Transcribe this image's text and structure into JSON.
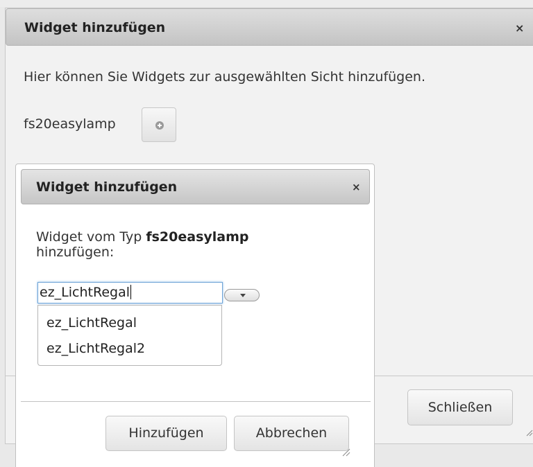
{
  "outer_dialog": {
    "title": "Widget hinzufügen",
    "close_glyph": "×",
    "description": "Hier können Sie Widgets zur ausgewählten Sicht hinzufügen.",
    "widget_type_label": "fs20easylamp",
    "add_icon": "plus-circle-icon",
    "close_button_label": "Schließen"
  },
  "inner_dialog": {
    "title": "Widget hinzufügen",
    "close_glyph": "×",
    "prompt_prefix": "Widget vom Typ ",
    "prompt_type": "fs20easylamp",
    "prompt_suffix": "hinzufügen:",
    "combo_value": "ez_LichtRegal",
    "combo_toggle_icon": "triangle-down-icon",
    "dropdown_options": [
      "ez_LichtRegal",
      "ez_LichtRegal2"
    ],
    "add_button_label": "Hinzufügen",
    "cancel_button_label": "Abbrechen"
  },
  "colors": {
    "focus_border": "#6fa4d6",
    "header_gradient_top": "#dedede",
    "header_gradient_bottom": "#c4c4c4"
  }
}
